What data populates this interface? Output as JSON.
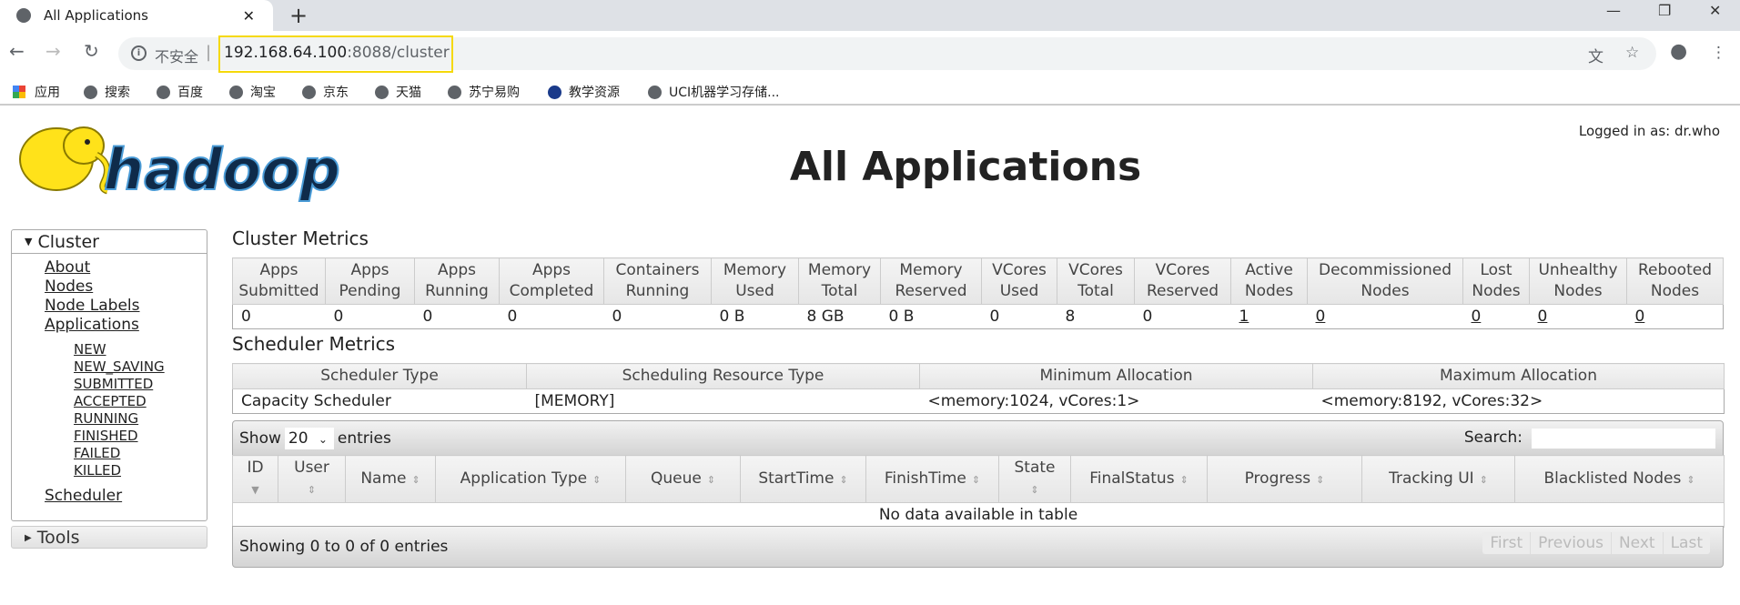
{
  "browser": {
    "tab_title": "All Applications",
    "url_host": "192.168.64.100",
    "url_rest": ":8088/cluster",
    "insecure_label": "不安全",
    "bookmarks": [
      "应用",
      "搜索",
      "百度",
      "淘宝",
      "京东",
      "天猫",
      "苏宁易购",
      "教学资源",
      "UCI机器学习存储..."
    ]
  },
  "header": {
    "logo_text": "hadoop",
    "title": "All Applications",
    "logged_in": "Logged in as: dr.who"
  },
  "sidebar": {
    "cluster": "Cluster",
    "items": [
      "About",
      "Nodes",
      "Node Labels",
      "Applications"
    ],
    "states": [
      "NEW",
      "NEW_SAVING",
      "SUBMITTED",
      "ACCEPTED",
      "RUNNING",
      "FINISHED",
      "FAILED",
      "KILLED"
    ],
    "scheduler": "Scheduler",
    "tools": "Tools"
  },
  "cluster_metrics": {
    "title": "Cluster Metrics",
    "headers": [
      "Apps Submitted",
      "Apps Pending",
      "Apps Running",
      "Apps Completed",
      "Containers Running",
      "Memory Used",
      "Memory Total",
      "Memory Reserved",
      "VCores Used",
      "VCores Total",
      "VCores Reserved",
      "Active Nodes",
      "Decommissioned Nodes",
      "Lost Nodes",
      "Unhealthy Nodes",
      "Rebooted Nodes"
    ],
    "values": [
      "0",
      "0",
      "0",
      "0",
      "0",
      "0 B",
      "8 GB",
      "0 B",
      "0",
      "8",
      "0",
      "1",
      "0",
      "0",
      "0",
      "0"
    ]
  },
  "scheduler_metrics": {
    "title": "Scheduler Metrics",
    "headers": [
      "Scheduler Type",
      "Scheduling Resource Type",
      "Minimum Allocation",
      "Maximum Allocation"
    ],
    "values": [
      "Capacity Scheduler",
      "[MEMORY]",
      "<memory:1024, vCores:1>",
      "<memory:8192, vCores:32>"
    ]
  },
  "apps_table": {
    "show": "Show",
    "entries_value": "20",
    "entries": "entries",
    "search_label": "Search:",
    "search_value": "",
    "headers": [
      "ID",
      "User",
      "Name",
      "Application Type",
      "Queue",
      "StartTime",
      "FinishTime",
      "State",
      "FinalStatus",
      "Progress",
      "Tracking UI",
      "Blacklisted Nodes"
    ],
    "empty": "No data available in table",
    "info": "Showing 0 to 0 of 0 entries",
    "pagination": [
      "First",
      "Previous",
      "Next",
      "Last"
    ]
  }
}
